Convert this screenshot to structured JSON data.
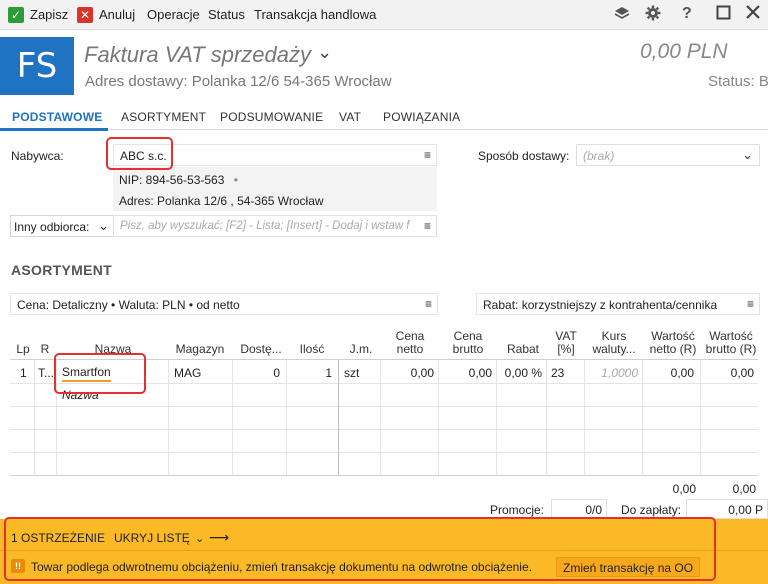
{
  "toolbar": {
    "save": "Zapisz",
    "cancel": "Anuluj",
    "operations": "Operacje",
    "status": "Status",
    "trade_transaction": "Transakcja handlowa"
  },
  "header": {
    "logo": "FS",
    "title": "Faktura VAT sprzedaży",
    "title_chevron": "⌄",
    "address": "Adres dostawy: Polanka  12/6  54-365 Wrocław",
    "amount": "0,00 PLN",
    "status": "Status: B"
  },
  "tabs": [
    {
      "label": "PODSTAWOWE"
    },
    {
      "label": "ASORTYMENT"
    },
    {
      "label": "PODSUMOWANIE"
    },
    {
      "label": "VAT"
    },
    {
      "label": "POWIĄZANIA"
    }
  ],
  "buyer": {
    "label": "Nabywca:",
    "value": "ABC s.c.",
    "nip": "NIP:  894-56-53-563",
    "address": "Adres:  Polanka  12/6 , 54-365 Wrocław"
  },
  "delivery": {
    "label": "Sposób dostawy:",
    "value": "(brak)"
  },
  "other_recipient": {
    "label": "Inny odbiorca:",
    "placeholder": "Pisz, aby wyszukać; [F2] - Lista; [Insert] - Dodaj i wstaw f"
  },
  "assortment": {
    "title": "ASORTYMENT",
    "price_info": "Cena: Detaliczny • Waluta: PLN • od netto",
    "discount_info": "Rabat: korzystniejszy z kontrahenta/cennika"
  },
  "grid": {
    "headers": {
      "lp": "Lp",
      "r": "R",
      "name": "Nazwa",
      "warehouse": "Magazyn",
      "available": "Dostę...",
      "qty": "Ilość",
      "unit": "J.m.",
      "net1": "Cena",
      "net2": "netto",
      "gross1": "Cena",
      "gross2": "brutto",
      "discount": "Rabat",
      "vat1": "VAT",
      "vat2": "[%]",
      "rate1": "Kurs",
      "rate2": "waluty...",
      "netval1": "Wartość",
      "netval2": "netto (R)",
      "grossval1": "Wartość",
      "grossval2": "brutto (R)"
    },
    "row": {
      "lp": "1",
      "r": "T...",
      "name": "Smartfon",
      "warehouse": "MAG",
      "available": "0",
      "qty": "1",
      "unit": "szt",
      "net": "0,00",
      "gross": "0,00",
      "discount": "0,00 %",
      "vat": "23",
      "rate": "1,0000",
      "net_value": "0,00",
      "gross_value": "0,00"
    },
    "new_row_placeholder": "Nazwa",
    "totals": {
      "net": "0,00",
      "gross": "0,00"
    }
  },
  "summary": {
    "promo_label": "Promocje:",
    "promo_value": "0/0",
    "to_pay_label": "Do zapłaty:",
    "to_pay_value": "0,00 P"
  },
  "warning": {
    "count": "1 OSTRZEŻENIE",
    "hide": "UKRYJ LISTĘ",
    "arrow": "⟶",
    "message": "Towar podlega odwrotnemu obciążeniu, zmień transakcję dokumentu na odwrotne obciążenie.",
    "button": "Zmień transakcję na OO"
  }
}
